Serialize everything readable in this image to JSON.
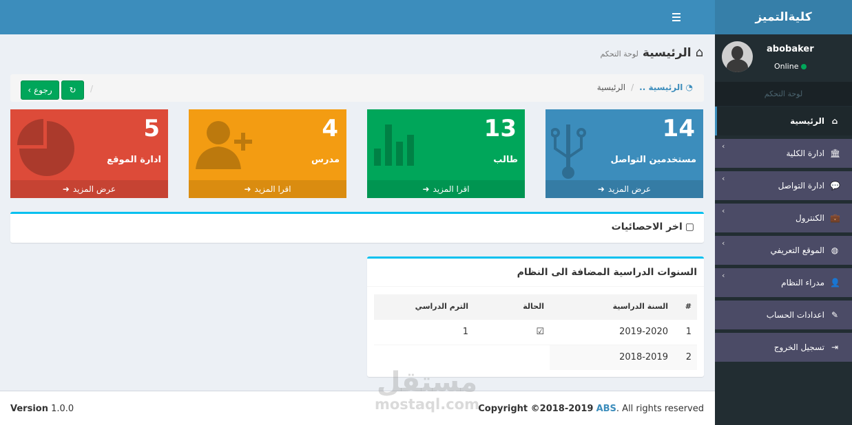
{
  "header": {
    "logo": "كليةالتميز"
  },
  "sidebar": {
    "user_name": "abobaker",
    "user_status": "Online",
    "section_header": "لوحة التحكم",
    "items": [
      {
        "label": "الرئيسية",
        "icon": "home-icon",
        "glyph": "⌂",
        "active": true,
        "has_sub": false
      },
      {
        "label": "ادارة الكلية",
        "icon": "institution-icon",
        "glyph": "🏛",
        "active": false,
        "has_sub": true
      },
      {
        "label": "ادارة التواصل",
        "icon": "chat-icon",
        "glyph": "💬",
        "active": false,
        "has_sub": true
      },
      {
        "label": "الكنترول",
        "icon": "briefcase-icon",
        "glyph": "💼",
        "active": false,
        "has_sub": true
      },
      {
        "label": "الموقع التعريفي",
        "icon": "globe-icon",
        "glyph": "◍",
        "active": false,
        "has_sub": true
      },
      {
        "label": "مدراء النظام",
        "icon": "user-secret-icon",
        "glyph": "👤",
        "active": false,
        "has_sub": true
      },
      {
        "label": "اعدادات الحساب",
        "icon": "edit-icon",
        "glyph": "✎",
        "active": false,
        "has_sub": false
      },
      {
        "label": "تسجيل الخروج",
        "icon": "sign-out-icon",
        "glyph": "⇥",
        "active": false,
        "has_sub": false
      }
    ]
  },
  "page": {
    "title": "الرئيسية",
    "subtitle": "لوحة التحكم"
  },
  "breadcrumb": {
    "home": "الرئيسية ..",
    "current": "الرئيسية"
  },
  "buttons": {
    "back": "رجوع"
  },
  "stats": [
    {
      "value": "14",
      "label": "مستخدمين التواصل",
      "footer": "عرض المزيد",
      "icon": "usb-icon",
      "color": "#3c8dbc"
    },
    {
      "value": "13",
      "label": "طالب",
      "footer": "اقرا المزيد",
      "icon": "bar-chart-icon",
      "color": "#00a65a"
    },
    {
      "value": "4",
      "label": "مدرس",
      "footer": "اقرا المزيد",
      "icon": "user-add-icon",
      "color": "#f39c12"
    },
    {
      "value": "5",
      "label": "ادارة الموقع",
      "footer": "عرض المزيد",
      "icon": "pie-chart-icon",
      "color": "#dd4b39"
    }
  ],
  "stats_panel": {
    "title": "اخر الاحصائيات"
  },
  "years_panel": {
    "title": "السنوات الدراسية المضافة الى النظام",
    "columns": [
      "#",
      "السنة الدراسية",
      "الحالة",
      "الترم الدراسي"
    ],
    "rows": [
      {
        "num": "1",
        "year": "2019-2020",
        "status_checked": true,
        "term": "1"
      },
      {
        "num": "2",
        "year": "2018-2019",
        "status_checked": false,
        "term": ""
      }
    ]
  },
  "footer": {
    "version_label": "Version",
    "version": "1.0.0",
    "copyright_prefix": "Copyright ©2018-2019",
    "brand": "ABS",
    "copyright_suffix": ". All rights reserved"
  },
  "watermark": {
    "arabic": "مستقل",
    "latin": "mostaql.com"
  }
}
